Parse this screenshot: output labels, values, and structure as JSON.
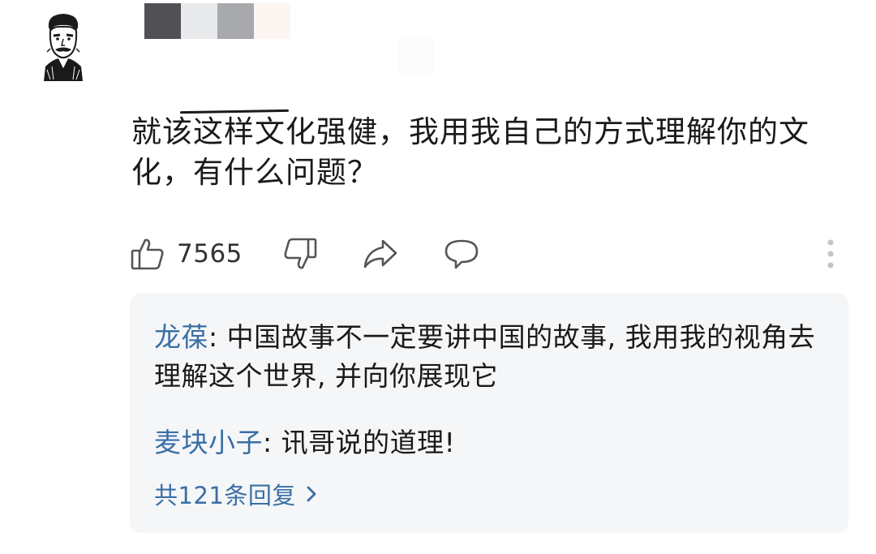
{
  "comment": {
    "author_avatar_icon": "portrait-avatar-icon",
    "name_redaction_colors": [
      "#505055",
      "#e8e9eb",
      "#a8a9ad",
      "#fcf5f2"
    ],
    "text": "就该这样文化强健，我用我自己的方式理解你的文化，有什么问题？",
    "likes": "7565"
  },
  "actions": {
    "like_icon": "thumbs-up-icon",
    "dislike_icon": "thumbs-down-icon",
    "share_icon": "share-arrow-icon",
    "reply_icon": "speech-bubble-icon",
    "more_icon": "more-vertical-icon"
  },
  "replies": [
    {
      "author": "龙葆",
      "separator": ": ",
      "text": "中国故事不一定要讲中国的故事, 我用我的视角去理解这个世界, 并向你展现它"
    },
    {
      "author": "麦块小子",
      "separator": ": ",
      "text": "讯哥说的道理!"
    }
  ],
  "view_more": {
    "label": "共121条回复",
    "icon": "chevron-right-icon"
  },
  "colors": {
    "link": "#3a6ea5",
    "reply_bg": "#f5f6f8",
    "text": "#1a1a1a"
  }
}
